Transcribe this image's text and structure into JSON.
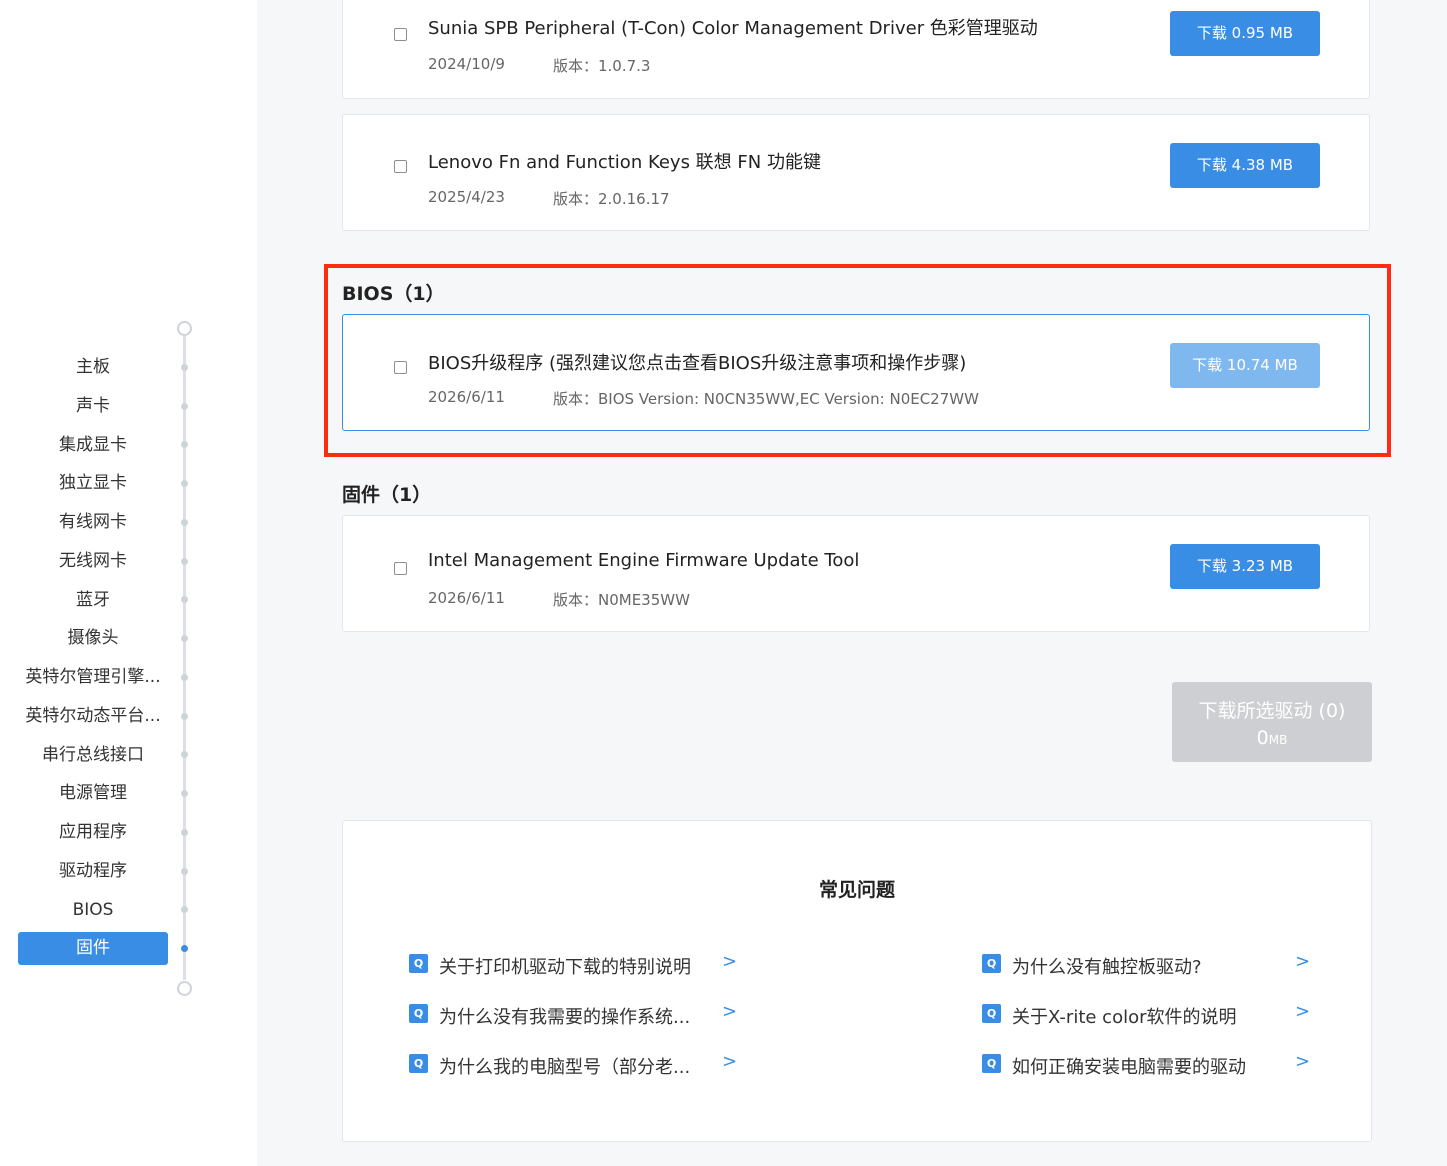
{
  "sidebar": {
    "items": [
      {
        "label": "主板"
      },
      {
        "label": "声卡"
      },
      {
        "label": "集成显卡"
      },
      {
        "label": "独立显卡"
      },
      {
        "label": "有线网卡"
      },
      {
        "label": "无线网卡"
      },
      {
        "label": "蓝牙"
      },
      {
        "label": "摄像头"
      },
      {
        "label": "英特尔管理引擎..."
      },
      {
        "label": "英特尔动态平台..."
      },
      {
        "label": "串行总线接口"
      },
      {
        "label": "电源管理"
      },
      {
        "label": "应用程序"
      },
      {
        "label": "驱动程序"
      },
      {
        "label": "BIOS"
      },
      {
        "label": "固件"
      }
    ],
    "active_label": "固件"
  },
  "drivers_top": [
    {
      "name": "Sunia SPB Peripheral (T-Con) Color Management Driver 色彩管理驱动",
      "date": "2024/10/9",
      "version": "版本：1.0.7.3",
      "button": "下载 0.95 MB"
    },
    {
      "name": "Lenovo Fn and Function Keys 联想 FN 功能键",
      "date": "2025/4/23",
      "version": "版本：2.0.16.17",
      "button": "下载 4.38 MB"
    }
  ],
  "bios": {
    "title": "BIOS（1）",
    "name": "BIOS升级程序 (强烈建议您点击查看BIOS升级注意事项和操作步骤)",
    "date": "2026/6/11",
    "version": "版本：BIOS Version: N0CN35WW,EC Version: N0EC27WW",
    "button": "下载 10.74 MB"
  },
  "firmware": {
    "title": "固件（1）",
    "name": "Intel Management Engine Firmware Update Tool",
    "date": "2026/6/11",
    "version": "版本：N0ME35WW",
    "button": "下载 3.23 MB"
  },
  "download_all": {
    "label": "下载所选驱动 (0)",
    "size_value": "0",
    "size_unit": "MB"
  },
  "faq": {
    "title": "常见问题",
    "icon_letter": "Q",
    "arrow": ">",
    "items": [
      {
        "text": "关于打印机驱动下载的特别说明"
      },
      {
        "text": "为什么没有触控板驱动?"
      },
      {
        "text": "为什么没有我需要的操作系统..."
      },
      {
        "text": "关于X-rite color软件的说明"
      },
      {
        "text": "为什么我的电脑型号（部分老..."
      },
      {
        "text": "如何正确安装电脑需要的驱动"
      }
    ]
  },
  "colors": {
    "accent": "#3a8de4",
    "highlight_border": "#ff2d10",
    "disabled_button": "#cdcfd2"
  }
}
